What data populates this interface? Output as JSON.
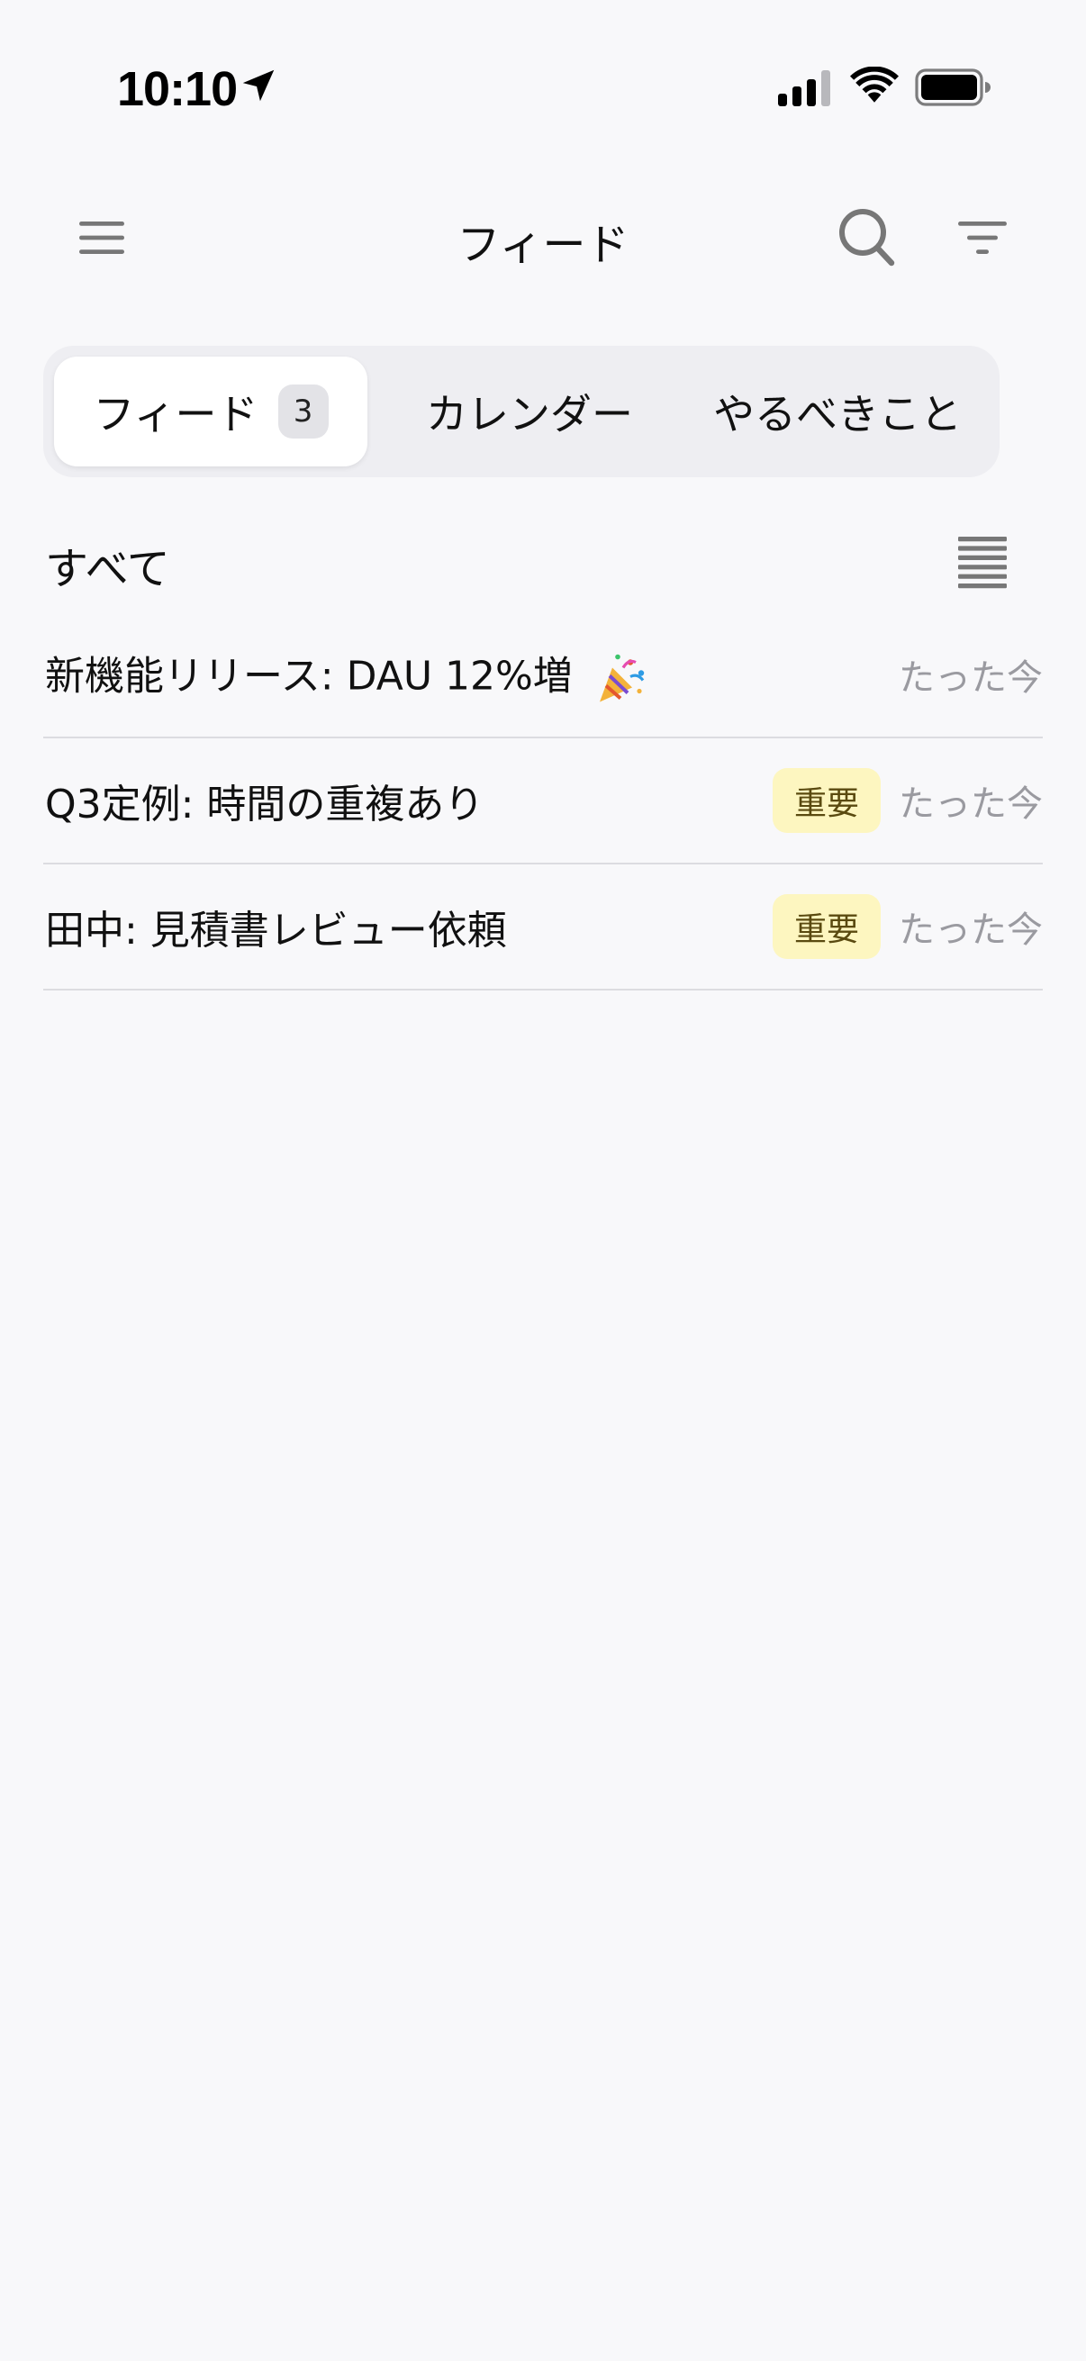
{
  "status_bar": {
    "time": "10:10",
    "icons": [
      "location-arrow-icon",
      "cellular-signal-icon",
      "wifi-icon",
      "battery-icon"
    ]
  },
  "header": {
    "title": "フィード",
    "icons": [
      "menu-icon",
      "search-icon",
      "filter-icon"
    ]
  },
  "tabs": [
    {
      "label": "フィード",
      "badge": "3",
      "active": true
    },
    {
      "label": "カレンダー",
      "active": false
    },
    {
      "label": "やるべきこと",
      "active": false
    }
  ],
  "section": {
    "title": "すべて",
    "view_toggle_icon": "list-view-icon"
  },
  "feed": [
    {
      "title": "新機能リリース: DAU 12%増",
      "emoji_icon": "party-popper-icon",
      "badge": "",
      "time": "たった今"
    },
    {
      "title": "Q3定例: 時間の重複あり",
      "badge": "重要",
      "time": "たった今"
    },
    {
      "title": "田中: 見積書レビュー依頼",
      "badge": "重要",
      "time": "たった今"
    }
  ],
  "colors": {
    "background": "#f8f8fa",
    "badge_bg": "#fdf6c0",
    "badge_text": "#5a4a10",
    "muted_text": "#9a9aa0"
  }
}
